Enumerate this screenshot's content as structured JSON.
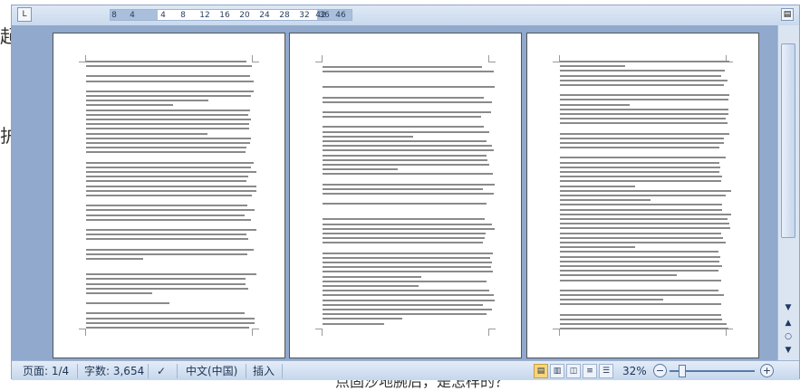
{
  "ruler": {
    "ticks": [
      "8",
      "4",
      "4",
      "8",
      "12",
      "16",
      "20",
      "24",
      "28",
      "32",
      "36",
      "42",
      "46"
    ]
  },
  "status": {
    "page": "页面: 1/4",
    "words": "字数: 3,654",
    "language": "中文(中国)",
    "mode": "插入",
    "zoom": "32%"
  },
  "background": {
    "frag1": "起",
    "frag2": "护",
    "frag3": "点固沙地腕后，是怎样的？"
  }
}
